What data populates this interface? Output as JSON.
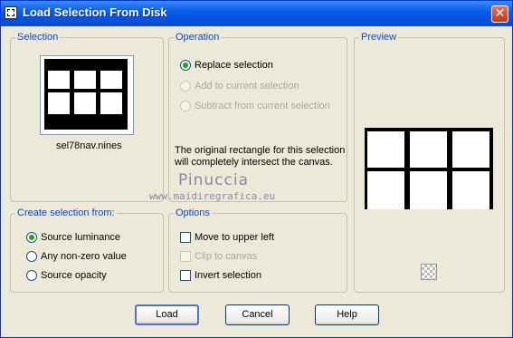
{
  "window": {
    "title": "Load Selection From Disk",
    "close": "✕"
  },
  "selection_group": {
    "label": "Selection",
    "file_name": "sel78nav.nines"
  },
  "operation_group": {
    "label": "Operation",
    "options": [
      "Replace selection",
      "Add to current selection",
      "Subtract from current selection"
    ],
    "selected": "Replace selection",
    "note_line1": "The original rectangle for this selection",
    "note_line2": "will completely intersect the canvas."
  },
  "preview_group": {
    "label": "Preview"
  },
  "create_group": {
    "label": "Create selection from:",
    "options": [
      "Source luminance",
      "Any non-zero value",
      "Source opacity"
    ],
    "selected": "Source luminance"
  },
  "options_group": {
    "label": "Options",
    "move_to_upper_left": "Move to upper left",
    "clip_to_canvas": "Clip to canvas",
    "invert_selection": "Invert selection"
  },
  "watermark": {
    "name": "Pinuccia",
    "url": "www.maidiregrafica.eu"
  },
  "buttons": {
    "load": "Load",
    "cancel": "Cancel",
    "help": "Help"
  }
}
